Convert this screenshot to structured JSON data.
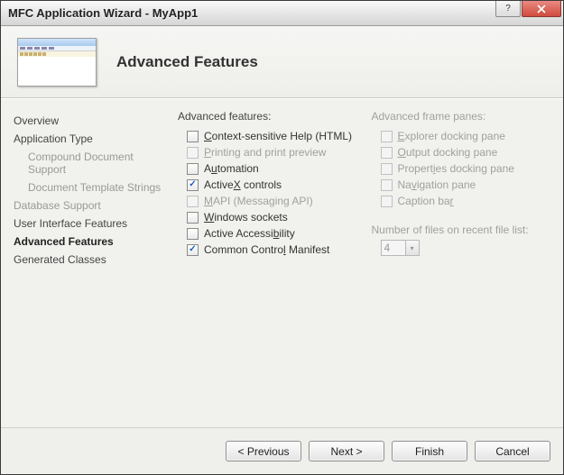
{
  "window": {
    "title": "MFC Application Wizard - MyApp1"
  },
  "page": {
    "title": "Advanced Features"
  },
  "nav": {
    "items": [
      {
        "label": "Overview",
        "active": false
      },
      {
        "label": "Application Type",
        "active": false
      },
      {
        "label": "Compound Document Support",
        "active": false,
        "sub": true,
        "disabled": true
      },
      {
        "label": "Document Template Strings",
        "active": false,
        "sub": true,
        "disabled": true
      },
      {
        "label": "Database Support",
        "active": false,
        "disabled": true
      },
      {
        "label": "User Interface Features",
        "active": false
      },
      {
        "label": "Advanced Features",
        "active": true
      },
      {
        "label": "Generated Classes",
        "active": false
      }
    ]
  },
  "advanced_features": {
    "heading": "Advanced features:",
    "items": [
      {
        "labelPre": "",
        "u": "C",
        "labelPost": "ontext-sensitive Help (HTML)",
        "checked": false,
        "disabled": false
      },
      {
        "labelPre": "",
        "u": "P",
        "labelPost": "rinting and print preview",
        "checked": false,
        "disabled": true
      },
      {
        "labelPre": "A",
        "u": "u",
        "labelPost": "tomation",
        "checked": false,
        "disabled": false
      },
      {
        "labelPre": "Active",
        "u": "X",
        "labelPost": " controls",
        "checked": true,
        "disabled": false
      },
      {
        "labelPre": "",
        "u": "M",
        "labelPost": "API (Messaging API)",
        "checked": false,
        "disabled": true
      },
      {
        "labelPre": "",
        "u": "W",
        "labelPost": "indows sockets",
        "checked": false,
        "disabled": false
      },
      {
        "labelPre": "Active Accessi",
        "u": "b",
        "labelPost": "ility",
        "checked": false,
        "disabled": false
      },
      {
        "labelPre": "Common Contro",
        "u": "l",
        "labelPost": " Manifest",
        "checked": true,
        "disabled": false
      }
    ]
  },
  "frame_panes": {
    "heading": "Advanced frame panes:",
    "items": [
      {
        "labelPre": "",
        "u": "E",
        "labelPost": "xplorer docking pane"
      },
      {
        "labelPre": "",
        "u": "O",
        "labelPost": "utput docking pane"
      },
      {
        "labelPre": "Propert",
        "u": "i",
        "labelPost": "es docking pane"
      },
      {
        "labelPre": "Na",
        "u": "v",
        "labelPost": "igation pane"
      },
      {
        "labelPre": "Caption ba",
        "u": "r",
        "labelPost": ""
      }
    ]
  },
  "recent": {
    "label": "Number of files on recent file list:",
    "value": "4"
  },
  "buttons": {
    "previous": "< Previous",
    "next": "Next >",
    "finish": "Finish",
    "cancel": "Cancel"
  }
}
